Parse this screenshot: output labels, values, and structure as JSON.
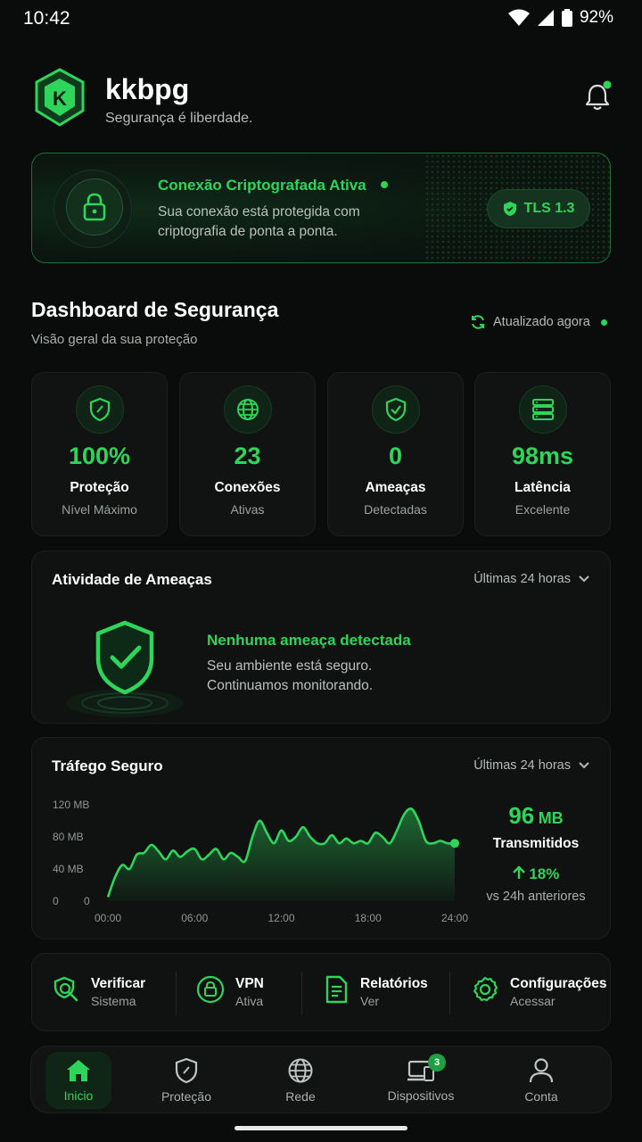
{
  "status_bar": {
    "time": "10:42",
    "battery": "92%"
  },
  "header": {
    "title": "kkbpg",
    "subtitle": "Segurança é liberdade.",
    "logo_letter": "K"
  },
  "connection": {
    "title": "Conexão Criptografada Ativa",
    "description": "Sua conexão está protegida com criptografia de ponta a ponta.",
    "tls_label": "TLS 1.3"
  },
  "dashboard": {
    "title": "Dashboard de Segurança",
    "subtitle": "Visão geral da sua proteção",
    "updated": "Atualizado agora"
  },
  "stats": [
    {
      "icon": "shield-icon",
      "value": "100%",
      "label": "Proteção",
      "sub": "Nível Máximo"
    },
    {
      "icon": "globe-icon",
      "value": "23",
      "label": "Conexões",
      "sub": "Ativas"
    },
    {
      "icon": "shield-check-icon",
      "value": "0",
      "label": "Ameaças",
      "sub": "Detectadas"
    },
    {
      "icon": "server-icon",
      "value": "98ms",
      "label": "Latência",
      "sub": "Excelente"
    }
  ],
  "threats": {
    "title": "Atividade de Ameaças",
    "range": "Últimas 24 horas",
    "status_title": "Nenhuma ameaça detectada",
    "status_desc": "Seu ambiente está seguro. Continuamos monitorando."
  },
  "traffic": {
    "title": "Tráfego Seguro",
    "range": "Últimas 24 horas",
    "value": "96",
    "unit": "MB",
    "value_label": "Transmitidos",
    "change": "18%",
    "change_sub": "vs 24h anteriores"
  },
  "chart_data": {
    "type": "area",
    "title": "Tráfego Seguro",
    "x_ticks": [
      "00:00",
      "06:00",
      "12:00",
      "18:00",
      "24:00"
    ],
    "y_ticks": [
      "0",
      "40 MB",
      "80 MB",
      "120 MB"
    ],
    "y_zero_label": "0",
    "ylim": [
      0,
      120
    ],
    "xlim": [
      0,
      24
    ],
    "x": [
      0,
      0.5,
      1,
      1.5,
      2,
      2.5,
      3,
      3.5,
      4,
      4.5,
      5,
      5.5,
      6,
      6.5,
      7,
      7.5,
      8,
      8.5,
      9,
      9.5,
      10,
      10.5,
      11,
      11.5,
      12,
      12.5,
      13,
      13.5,
      14,
      14.5,
      15,
      15.5,
      16,
      16.5,
      17,
      17.5,
      18,
      18.5,
      19,
      19.5,
      20,
      20.5,
      21,
      21.5,
      22,
      22.5,
      23,
      23.5,
      24
    ],
    "series": [
      {
        "values": [
          5,
          30,
          45,
          40,
          58,
          60,
          70,
          62,
          52,
          63,
          55,
          62,
          65,
          52,
          58,
          65,
          52,
          60,
          55,
          50,
          80,
          100,
          85,
          72,
          88,
          75,
          80,
          92,
          80,
          72,
          72,
          82,
          72,
          78,
          72,
          75,
          72,
          85,
          80,
          72,
          88,
          108,
          115,
          100,
          75,
          72,
          75,
          72,
          72
        ]
      }
    ],
    "grid": false,
    "legend": "none"
  },
  "quick_actions": [
    {
      "icon": "search-shield-icon",
      "title": "Verificar",
      "sub": "Sistema"
    },
    {
      "icon": "vpn-lock-icon",
      "title": "VPN",
      "sub": "Ativa"
    },
    {
      "icon": "report-icon",
      "title": "Relatórios",
      "sub": "Ver"
    },
    {
      "icon": "gear-icon",
      "title": "Configurações",
      "sub": "Acessar"
    }
  ],
  "nav": [
    {
      "icon": "home-icon",
      "label": "Inicio",
      "active": true
    },
    {
      "icon": "shield-icon",
      "label": "Proteção"
    },
    {
      "icon": "globe-icon",
      "label": "Rede"
    },
    {
      "icon": "devices-icon",
      "label": "Dispositivos",
      "badge": "3"
    },
    {
      "icon": "user-icon",
      "label": "Conta"
    }
  ],
  "colors": {
    "accent": "#2fd45a",
    "background": "#0a0c0b",
    "card": "#0f1211"
  }
}
